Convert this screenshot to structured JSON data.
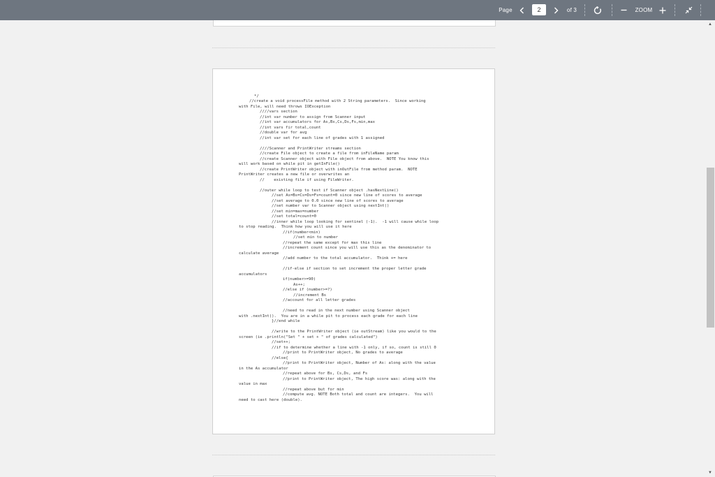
{
  "toolbar": {
    "page_label": "Page",
    "current_page": "2",
    "of_label": "of 3",
    "zoom_label": "ZOOM",
    "icons": {
      "prev": "chevron-left-icon",
      "next": "chevron-right-icon",
      "rotate": "rotate-icon",
      "zoom_out": "minus-icon",
      "zoom_in": "plus-icon",
      "collapse": "collapse-icon"
    }
  },
  "document": {
    "lines": [
      "*/",
      "//create a void processFile method with 2 String parameters.  Since working",
      "with File, will need throws IOException",
      "////vars section",
      "//int var number to assign from Scanner input",
      "//int var accumulators for As,Bs,Cs,Ds,Fs,min,max",
      "//int vars fir total,count",
      "//double var for avg",
      "//int var set for each line of grades with 1 assigned",
      "////Scanner and PrintWriter streams section",
      "//create File object to create a file from inFileName param",
      "//create Scanner object with File object from above.  NOTE You know this",
      "will work based on while pit in getInFile()",
      "//create PrintWriter object with inOutFile from method param.  NOTE",
      "PrintWriter creates a new file or overwrites an",
      "//    existing file if using FileWriter.",
      "//outer while loop to test if Scanner object .hasNextLine()",
      "//set As=Bs=Cs=Ds=Fs=count=0 since new line of scores to average",
      "//set average to 0.0 since new line of scores to average",
      "//set number var to Scanner object using nextInt()",
      "//set min=max=number",
      "//set total=count=0",
      "//inner while loop looking for sentinel (-1).  -1 will cause while loop",
      "to stop reading.  Think how you will use it here",
      "//if(number<min)",
      "//set min to number",
      "//repeat the same except for max this line",
      "//increment count since you will use this as the denominator to",
      "calculate average",
      "//add number to the total accumulator.  Think += here",
      "//if-else if section to set increment the proper letter grade",
      "accumulators",
      "if(number>=90)",
      "As++;",
      "//else if (number>=?)",
      "//increment Bs",
      "//account for all letter grades",
      "//need to read in the next number using Scanner object",
      "with .nextInt().  You are in a while pit to process each grade for each line",
      "}//end while",
      "//write to the PrintWriter object (ie outStream) like you would to the",
      "screen (ie .println(\"Set \" + set + \" of grades calculated\")",
      "//set++;",
      "//if to determine whether a line with -1 only, if so, count is still 0",
      "//print to PrintWriter object, No grades to average",
      "//else{",
      "//print to PrintWriter object, Number of As: along with the value",
      "in the As accumulator",
      "//repeat above for Bs, Cs,Ds, and Fs",
      "//print to PrintWriter object, The high score was: along with the",
      "value in max",
      "//repeat above but for min",
      "//compute avg. NOTE Both total and count are integers.  You will",
      "need to cast here (double)."
    ]
  }
}
